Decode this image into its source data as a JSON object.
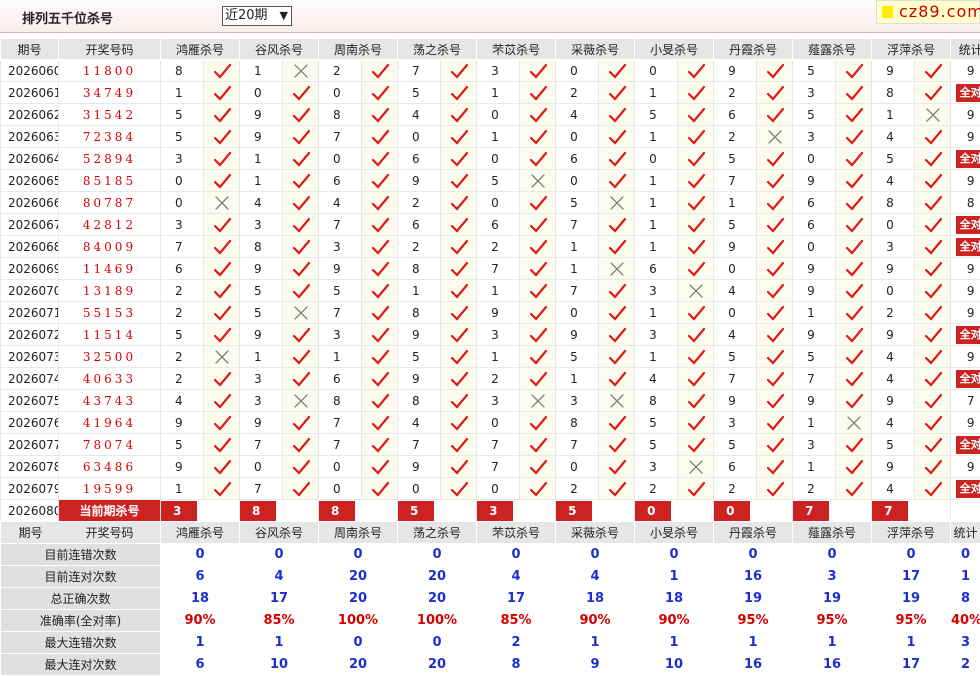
{
  "page": {
    "title": "排列五千位杀号",
    "period_select": "近20期",
    "logo": "cz89.com"
  },
  "colors": {
    "accent_red": "#cc2222",
    "check": "#e01818",
    "cross": "#808080",
    "stat_blue": "#1d2fd0"
  },
  "icons": {
    "correct": "check-icon",
    "wrong": "cross-icon"
  },
  "columns": {
    "issue": "期号",
    "draw": "开奖号码",
    "experts": [
      "鸿雁杀号",
      "谷风杀号",
      "周南杀号",
      "荡之杀号",
      "芣苡杀号",
      "采薇杀号",
      "小旻杀号",
      "丹霞杀号",
      "薤露杀号",
      "浮萍杀号"
    ],
    "stat": "统计"
  },
  "rows": [
    {
      "issue": "2026060",
      "draw": "11800",
      "kills": [
        8,
        1,
        2,
        7,
        3,
        0,
        0,
        9,
        5,
        9
      ],
      "ok": [
        1,
        0,
        1,
        1,
        1,
        1,
        1,
        1,
        1,
        1
      ],
      "stat": "9"
    },
    {
      "issue": "2026061",
      "draw": "34749",
      "kills": [
        1,
        0,
        0,
        5,
        1,
        2,
        1,
        2,
        3,
        8
      ],
      "ok": [
        1,
        1,
        1,
        1,
        1,
        1,
        1,
        1,
        1,
        1
      ],
      "stat": "全对"
    },
    {
      "issue": "2026062",
      "draw": "31542",
      "kills": [
        5,
        9,
        8,
        4,
        0,
        4,
        5,
        6,
        5,
        1
      ],
      "ok": [
        1,
        1,
        1,
        1,
        1,
        1,
        1,
        1,
        1,
        0
      ],
      "stat": "9"
    },
    {
      "issue": "2026063",
      "draw": "72384",
      "kills": [
        5,
        9,
        7,
        0,
        1,
        0,
        1,
        2,
        3,
        4
      ],
      "ok": [
        1,
        1,
        1,
        1,
        1,
        1,
        1,
        0,
        1,
        1
      ],
      "stat": "9"
    },
    {
      "issue": "2026064",
      "draw": "52894",
      "kills": [
        3,
        1,
        0,
        6,
        0,
        6,
        0,
        5,
        0,
        5
      ],
      "ok": [
        1,
        1,
        1,
        1,
        1,
        1,
        1,
        1,
        1,
        1
      ],
      "stat": "全对"
    },
    {
      "issue": "2026065",
      "draw": "85185",
      "kills": [
        0,
        1,
        6,
        9,
        5,
        0,
        1,
        7,
        9,
        4
      ],
      "ok": [
        1,
        1,
        1,
        1,
        0,
        1,
        1,
        1,
        1,
        1
      ],
      "stat": "9"
    },
    {
      "issue": "2026066",
      "draw": "80787",
      "kills": [
        0,
        4,
        4,
        2,
        0,
        5,
        1,
        1,
        6,
        8
      ],
      "ok": [
        0,
        1,
        1,
        1,
        1,
        0,
        1,
        1,
        1,
        1
      ],
      "stat": "8"
    },
    {
      "issue": "2026067",
      "draw": "42812",
      "kills": [
        3,
        3,
        7,
        6,
        6,
        7,
        1,
        5,
        6,
        0
      ],
      "ok": [
        1,
        1,
        1,
        1,
        1,
        1,
        1,
        1,
        1,
        1
      ],
      "stat": "全对"
    },
    {
      "issue": "2026068",
      "draw": "84009",
      "kills": [
        7,
        8,
        3,
        2,
        2,
        1,
        1,
        9,
        0,
        3
      ],
      "ok": [
        1,
        1,
        1,
        1,
        1,
        1,
        1,
        1,
        1,
        1
      ],
      "stat": "全对"
    },
    {
      "issue": "2026069",
      "draw": "11469",
      "kills": [
        6,
        9,
        9,
        8,
        7,
        1,
        6,
        0,
        9,
        9
      ],
      "ok": [
        1,
        1,
        1,
        1,
        1,
        0,
        1,
        1,
        1,
        1
      ],
      "stat": "9"
    },
    {
      "issue": "2026070",
      "draw": "13189",
      "kills": [
        2,
        5,
        5,
        1,
        1,
        7,
        3,
        4,
        9,
        0
      ],
      "ok": [
        1,
        1,
        1,
        1,
        1,
        1,
        0,
        1,
        1,
        1
      ],
      "stat": "9"
    },
    {
      "issue": "2026071",
      "draw": "55153",
      "kills": [
        2,
        5,
        7,
        8,
        9,
        0,
        1,
        0,
        1,
        2
      ],
      "ok": [
        1,
        0,
        1,
        1,
        1,
        1,
        1,
        1,
        1,
        1
      ],
      "stat": "9"
    },
    {
      "issue": "2026072",
      "draw": "11514",
      "kills": [
        5,
        9,
        3,
        9,
        3,
        9,
        3,
        4,
        9,
        9
      ],
      "ok": [
        1,
        1,
        1,
        1,
        1,
        1,
        1,
        1,
        1,
        1
      ],
      "stat": "全对"
    },
    {
      "issue": "2026073",
      "draw": "32500",
      "kills": [
        2,
        1,
        1,
        5,
        1,
        5,
        1,
        5,
        5,
        4
      ],
      "ok": [
        0,
        1,
        1,
        1,
        1,
        1,
        1,
        1,
        1,
        1
      ],
      "stat": "9"
    },
    {
      "issue": "2026074",
      "draw": "40633",
      "kills": [
        2,
        3,
        6,
        9,
        2,
        1,
        4,
        7,
        7,
        4
      ],
      "ok": [
        1,
        1,
        1,
        1,
        1,
        1,
        1,
        1,
        1,
        1
      ],
      "stat": "全对"
    },
    {
      "issue": "2026075",
      "draw": "43743",
      "kills": [
        4,
        3,
        8,
        8,
        3,
        3,
        8,
        9,
        9,
        9
      ],
      "ok": [
        1,
        0,
        1,
        1,
        0,
        0,
        1,
        1,
        1,
        1
      ],
      "stat": "7"
    },
    {
      "issue": "2026076",
      "draw": "41964",
      "kills": [
        9,
        9,
        7,
        4,
        0,
        8,
        5,
        3,
        1,
        4
      ],
      "ok": [
        1,
        1,
        1,
        1,
        1,
        1,
        1,
        1,
        0,
        1
      ],
      "stat": "9"
    },
    {
      "issue": "2026077",
      "draw": "78074",
      "kills": [
        5,
        7,
        7,
        7,
        7,
        7,
        5,
        5,
        3,
        5
      ],
      "ok": [
        1,
        1,
        1,
        1,
        1,
        1,
        1,
        1,
        1,
        1
      ],
      "stat": "全对"
    },
    {
      "issue": "2026078",
      "draw": "63486",
      "kills": [
        9,
        0,
        0,
        9,
        7,
        0,
        3,
        6,
        1,
        9
      ],
      "ok": [
        1,
        1,
        1,
        1,
        1,
        1,
        0,
        1,
        1,
        1
      ],
      "stat": "9"
    },
    {
      "issue": "2026079",
      "draw": "19599",
      "kills": [
        1,
        7,
        0,
        0,
        0,
        2,
        2,
        2,
        2,
        4
      ],
      "ok": [
        1,
        1,
        1,
        1,
        1,
        1,
        1,
        1,
        1,
        1
      ],
      "stat": "全对"
    }
  ],
  "current": {
    "issue": "2026080",
    "label": "当前期杀号",
    "kills": [
      3,
      8,
      8,
      5,
      3,
      5,
      0,
      0,
      7,
      7
    ]
  },
  "summary": {
    "rows": [
      {
        "label": "目前连错次数",
        "values": [
          "0",
          "0",
          "0",
          "0",
          "0",
          "0",
          "0",
          "0",
          "0",
          "0"
        ],
        "stat": "0"
      },
      {
        "label": "目前连对次数",
        "values": [
          "6",
          "4",
          "20",
          "20",
          "4",
          "4",
          "1",
          "16",
          "3",
          "17"
        ],
        "stat": "1"
      },
      {
        "label": "总正确次数",
        "values": [
          "18",
          "17",
          "20",
          "20",
          "17",
          "18",
          "18",
          "19",
          "19",
          "19"
        ],
        "stat": "8"
      },
      {
        "label": "准确率(全对率)",
        "values": [
          "90%",
          "85%",
          "100%",
          "100%",
          "85%",
          "90%",
          "90%",
          "95%",
          "95%",
          "95%"
        ],
        "stat": "40%"
      },
      {
        "label": "最大连错次数",
        "values": [
          "1",
          "1",
          "0",
          "0",
          "2",
          "1",
          "1",
          "1",
          "1",
          "1"
        ],
        "stat": "3"
      },
      {
        "label": "最大连对次数",
        "values": [
          "6",
          "10",
          "20",
          "20",
          "8",
          "9",
          "10",
          "16",
          "16",
          "17"
        ],
        "stat": "2"
      }
    ]
  }
}
